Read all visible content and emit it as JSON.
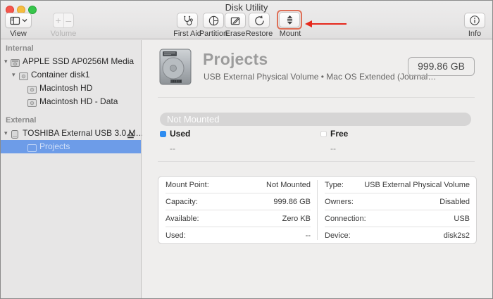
{
  "window": {
    "title": "Disk Utility"
  },
  "toolbar": {
    "view_label": "View",
    "volume_label": "Volume",
    "volume_plus": "+",
    "volume_minus": "–",
    "buttons": [
      {
        "label": "First Aid"
      },
      {
        "label": "Partition"
      },
      {
        "label": "Erase"
      },
      {
        "label": "Restore"
      },
      {
        "label": "Mount",
        "highlighted": true
      }
    ],
    "info_label": "Info"
  },
  "sidebar": {
    "sections": [
      {
        "header": "Internal",
        "items": [
          {
            "label": "APPLE SSD AP0256M Media"
          },
          {
            "label": "Container disk1"
          },
          {
            "label": "Macintosh HD"
          },
          {
            "label": "Macintosh HD - Data"
          }
        ]
      },
      {
        "header": "External",
        "items": [
          {
            "label": "TOSHIBA External USB 3.0 M…"
          },
          {
            "label": "Projects",
            "selected": true
          }
        ]
      }
    ]
  },
  "main": {
    "title": "Projects",
    "subtitle": "USB External Physical Volume • Mac OS Extended (Journal…",
    "size_badge": "999.86 GB",
    "status": "Not Mounted",
    "legend": {
      "used_label": "Used",
      "used_value": "--",
      "used_color": "#2e8cf0",
      "free_label": "Free",
      "free_value": "--",
      "free_color": "#ffffff"
    },
    "details_left": [
      {
        "label": "Mount Point:",
        "value": "Not Mounted"
      },
      {
        "label": "Capacity:",
        "value": "999.86 GB"
      },
      {
        "label": "Available:",
        "value": "Zero KB"
      },
      {
        "label": "Used:",
        "value": "--"
      }
    ],
    "details_right": [
      {
        "label": "Type:",
        "value": "USB External Physical Volume"
      },
      {
        "label": "Owners:",
        "value": "Disabled"
      },
      {
        "label": "Connection:",
        "value": "USB"
      },
      {
        "label": "Device:",
        "value": "disk2s2"
      }
    ]
  },
  "annotation": {
    "arrow_color": "#e6281c",
    "highlight_color": "#de7058"
  }
}
